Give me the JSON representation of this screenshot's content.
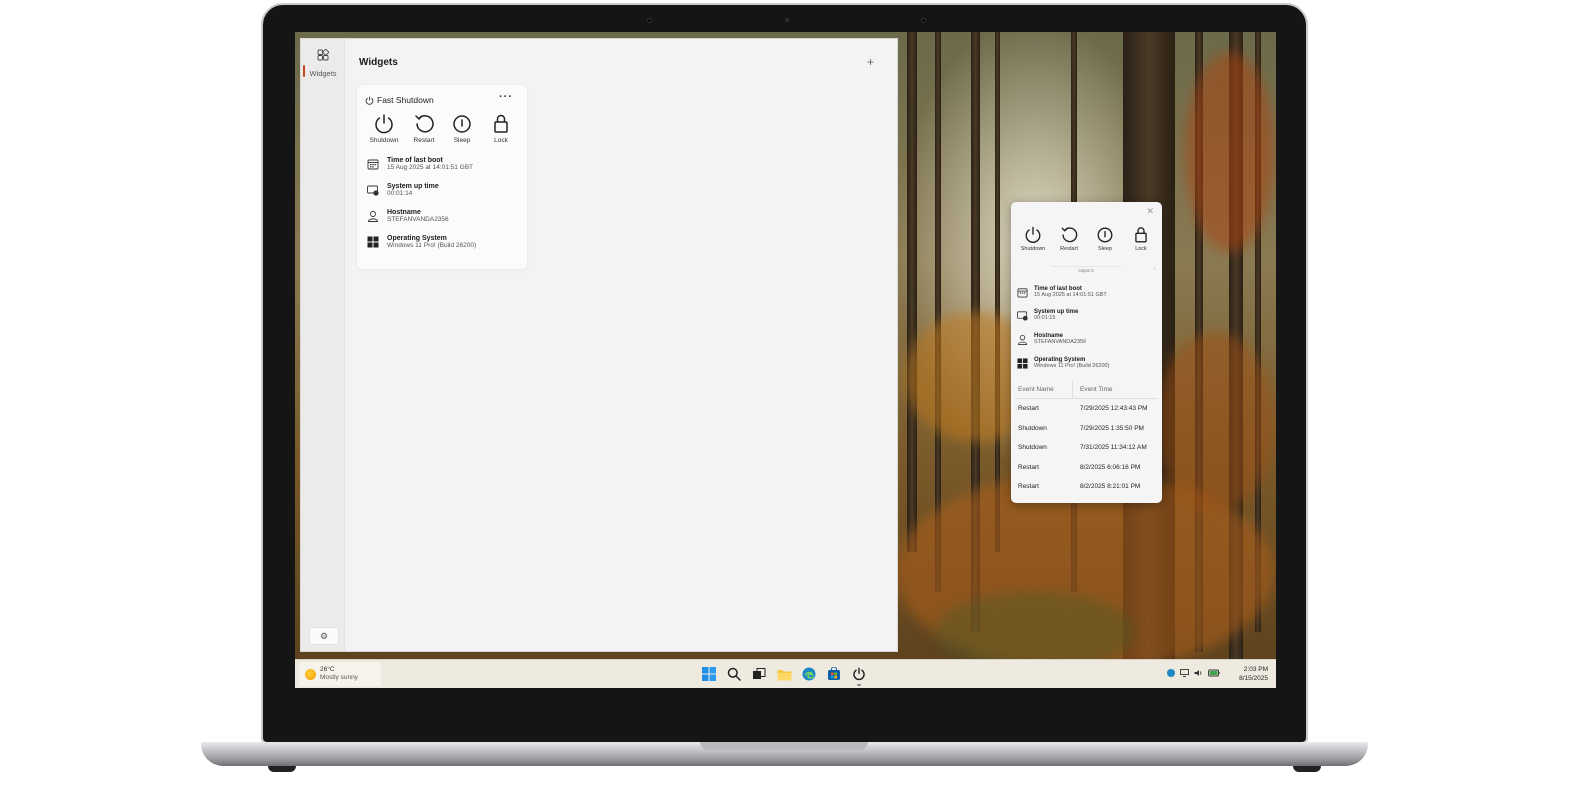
{
  "panel": {
    "rail_label": "Widgets",
    "title": "Widgets",
    "add_label": "+",
    "settings_icon": "gear-icon"
  },
  "card": {
    "title": "Fast Shutdown",
    "more_label": "···",
    "actions": [
      {
        "label": "Shutdown",
        "icon": "power-icon"
      },
      {
        "label": "Restart",
        "icon": "restart-icon"
      },
      {
        "label": "Sleep",
        "icon": "sleep-icon"
      },
      {
        "label": "Lock",
        "icon": "lock-icon"
      }
    ],
    "info": [
      {
        "title": "Time of last boot",
        "value": "15 Aug 2025 at 14:01:51 GBT",
        "icon": "calendar-icon"
      },
      {
        "title": "System up time",
        "value": "00:01:14",
        "icon": "uptime-icon"
      },
      {
        "title": "Hostname",
        "value": "STEFANVANDA2356",
        "icon": "user-icon"
      },
      {
        "title": "Operating System",
        "value": "Windows 11 Pro! (Build 26200)",
        "icon": "windows-icon"
      }
    ]
  },
  "floating": {
    "close_label": "✕",
    "actions": [
      {
        "label": "Shutdown"
      },
      {
        "label": "Restart"
      },
      {
        "label": "Sleep"
      },
      {
        "label": "Lock"
      }
    ],
    "unpin_label": "Unpin it",
    "info": [
      {
        "title": "Time of last boot",
        "value": "15 Aug 2025 at 14:01:51 GBT"
      },
      {
        "title": "System up time",
        "value": "00:01:15"
      },
      {
        "title": "Hostname",
        "value": "STEFANVANDA2356"
      },
      {
        "title": "Operating System",
        "value": "Windows 11 Pro! (Build 26200)"
      }
    ],
    "events": {
      "columns": [
        "Event Name",
        "Event Time"
      ],
      "rows": [
        [
          "Restart",
          "7/29/2025 12:43:43 PM"
        ],
        [
          "Shutdown",
          "7/29/2025 1:35:50 PM"
        ],
        [
          "Shutdown",
          "7/31/2025 11:34:12 AM"
        ],
        [
          "Restart",
          "8/2/2025 6:06:16 PM"
        ],
        [
          "Restart",
          "8/2/2025 8:21:01 PM"
        ]
      ]
    }
  },
  "taskbar": {
    "weather_temp": "26°C",
    "weather_desc": "Mostly sunny",
    "time": "2:03 PM",
    "date": "8/15/2025"
  },
  "colors": {
    "accent": "#c4461f",
    "taskbar": "#efeae0",
    "panel": "#f3f3f3"
  }
}
